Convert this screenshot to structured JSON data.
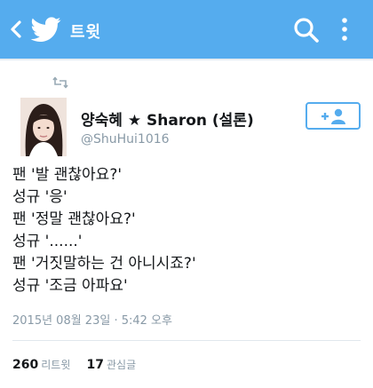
{
  "header": {
    "title": "트윗",
    "back_icon": "back-arrow-icon",
    "logo_icon": "twitter-bird-icon",
    "search_icon": "search-icon",
    "more_icon": "more-vertical-icon",
    "background_color": "#55acee"
  },
  "tweet": {
    "retweet_icon": "retweet-icon",
    "author_name": "양숙혜 ★ Sharon (설론)",
    "author_handle": "@ShuHui1016",
    "follow_icon": "follow-person-icon",
    "lines": [
      "팬 '발 괜찮아요?'",
      "성규 '응'",
      "팬 '정말 괜찮아요?'",
      "성규 '......'",
      "팬 '거짓말하는 건 아니시죠?'",
      "성규 '조금 아파요'"
    ],
    "timestamp": "2015년 08월 23일 · 5:42 오후",
    "stats": {
      "retweets_count": "260",
      "retweets_label": "리트윗",
      "likes_count": "17",
      "likes_label": "관심글"
    }
  }
}
